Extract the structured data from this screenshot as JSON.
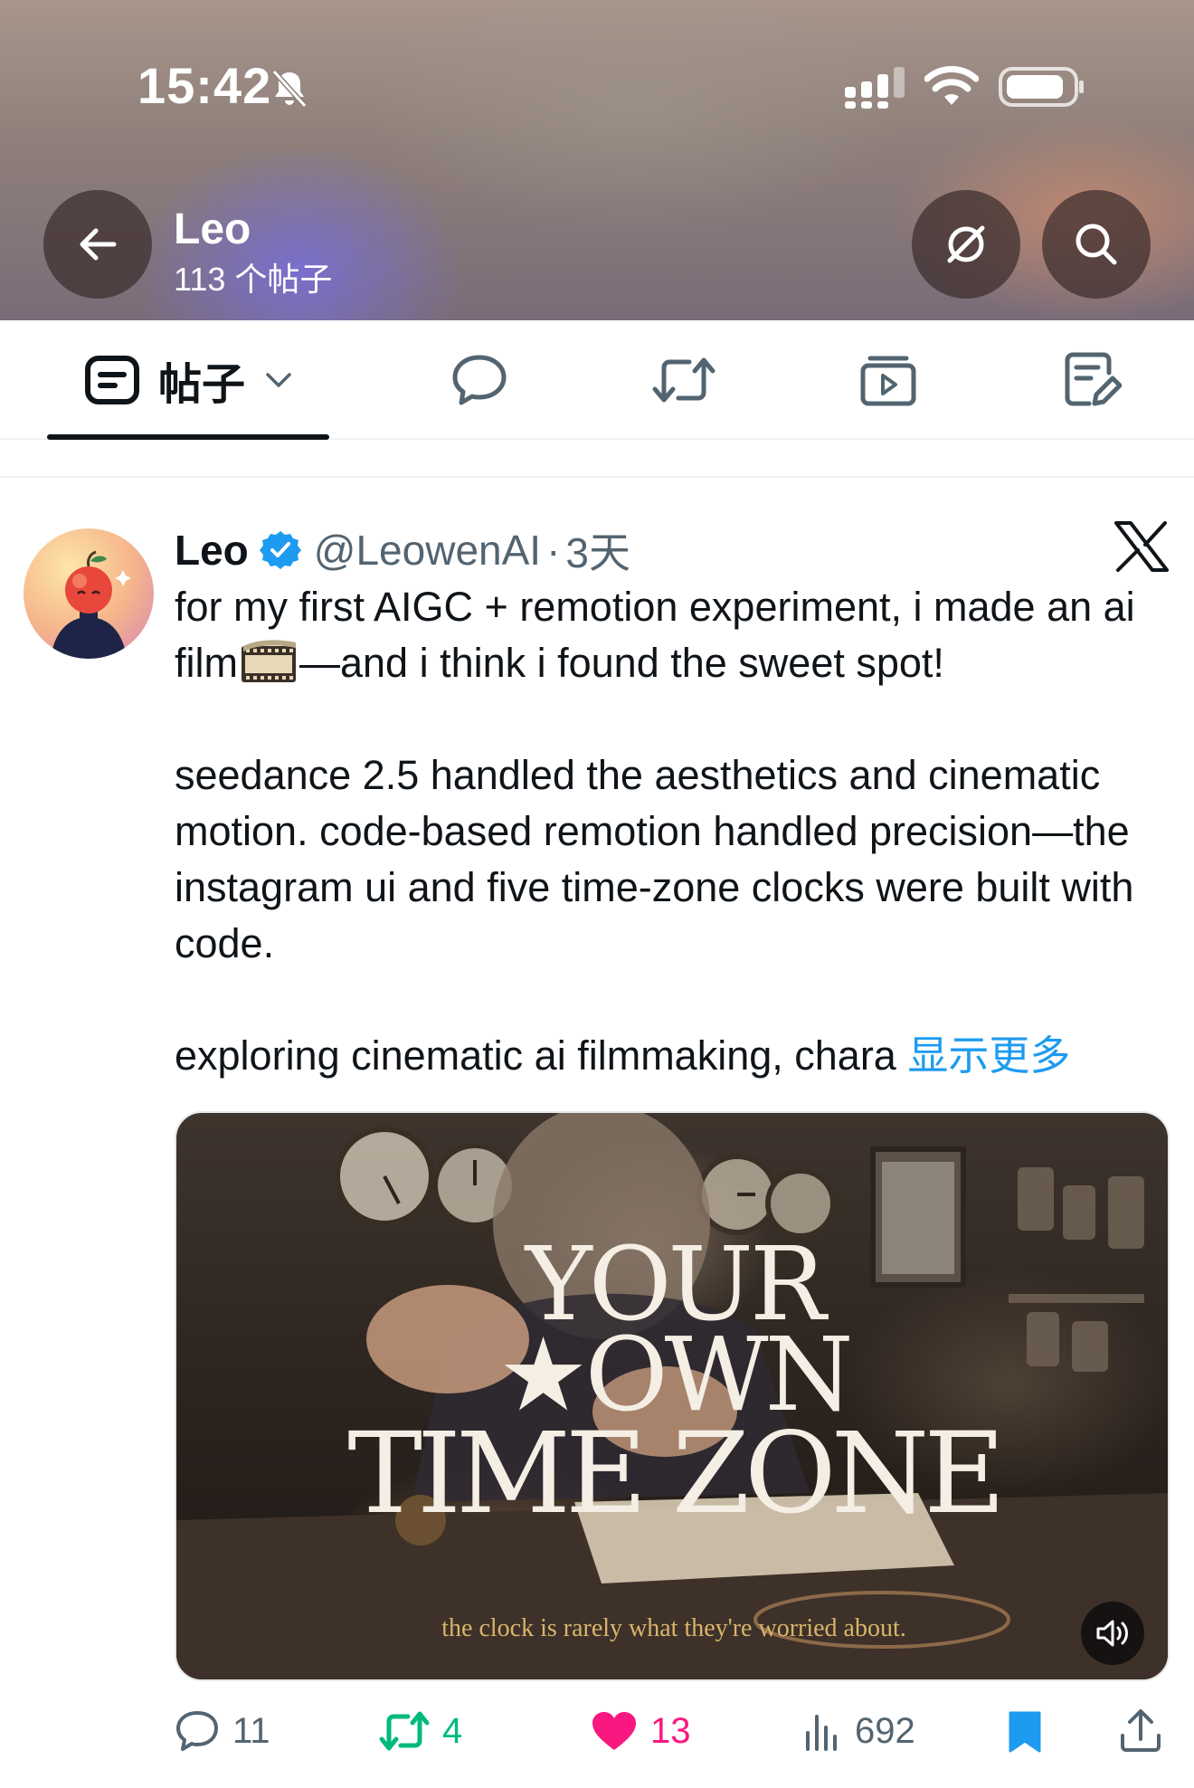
{
  "status_bar": {
    "time": "15:42"
  },
  "header": {
    "name": "Leo",
    "post_count": "113 个帖子"
  },
  "tabs": {
    "posts_label": "帖子"
  },
  "post": {
    "author_name": "Leo",
    "handle": "@LeowenAI",
    "separator": "·",
    "time": "3天",
    "text_part1": "for my first AIGC + remotion experiment, i made an ai film",
    "text_part2": "—and i think i found the sweet spot!\n\nseedance 2.5 handled the aesthetics and cinematic motion. code-based remotion handled precision—the instagram ui and five time-zone clocks were built with code.\n\nexploring cinematic ai filmmaking, chara ",
    "show_more": "显示更多",
    "media": {
      "title_line1": "YOUR",
      "title_line2": "★OWN",
      "title_line3": "TIME ZONE",
      "caption": "the clock is rarely what they're worried about."
    },
    "actions": {
      "replies": "11",
      "reposts": "4",
      "likes": "13",
      "views": "692"
    }
  },
  "colors": {
    "accent": "#1d9bf0",
    "repost": "#00ba7c",
    "like": "#f91880",
    "text": "#0f1419",
    "secondary": "#536471"
  },
  "icons": [
    "bell-slash-icon",
    "signal-icon",
    "wifi-icon",
    "battery-icon",
    "back-arrow-icon",
    "grok-icon",
    "search-icon",
    "posts-tab-icon",
    "chevron-down-icon",
    "reply-bubble-icon",
    "repost-icon",
    "media-play-icon",
    "article-edit-icon",
    "verified-badge-icon",
    "x-logo-icon",
    "film-strip-icon",
    "volume-icon",
    "heart-icon",
    "views-chart-icon",
    "bookmark-icon",
    "share-icon"
  ]
}
